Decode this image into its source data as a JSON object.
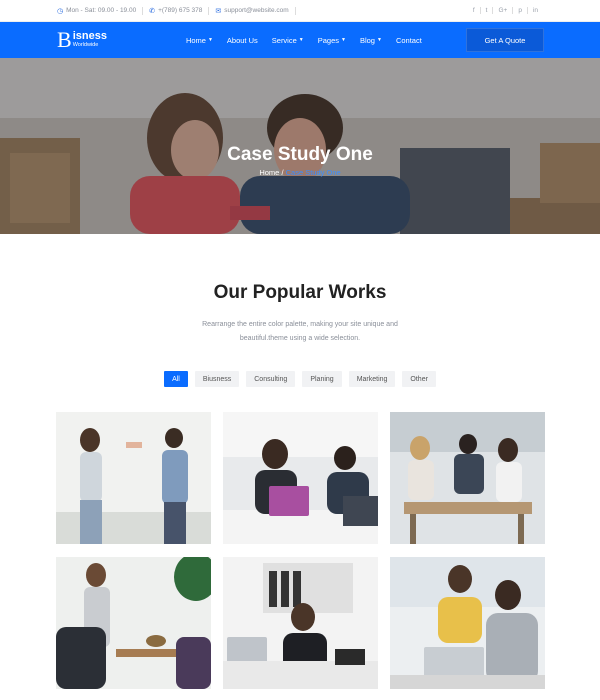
{
  "topbar": {
    "hours": "Mon - Sat: 09.00 - 19.00",
    "phone": "+(789) 675 378",
    "email": "support@website.com",
    "socials": [
      "f",
      "t",
      "G+",
      "p",
      "in"
    ],
    "icons": [
      "clock-icon",
      "phone-icon",
      "mail-icon"
    ]
  },
  "nav": {
    "logo_letter": "B",
    "logo_name": "isness",
    "logo_sub": "Worldwide",
    "items": [
      {
        "label": "Home",
        "dropdown": true
      },
      {
        "label": "About Us",
        "dropdown": false
      },
      {
        "label": "Service",
        "dropdown": true
      },
      {
        "label": "Pages",
        "dropdown": true
      },
      {
        "label": "Blog",
        "dropdown": true
      },
      {
        "label": "Contact",
        "dropdown": false
      }
    ],
    "cta": "Get A Quote"
  },
  "hero": {
    "title": "Case Study One",
    "breadcrumb_home": "Home",
    "breadcrumb_sep": "/",
    "breadcrumb_current": "Case Study One"
  },
  "works": {
    "title": "Our Popular Works",
    "desc_line1": "Rearrange the entire color palette, making your site unique and",
    "desc_line2": "beautiful.theme using a wide selection.",
    "filters": [
      "All",
      "Biusness",
      "Consulting",
      "Planing",
      "Marketing",
      "Other"
    ],
    "active_filter": "All"
  },
  "colors": {
    "brand": "#0a6cff",
    "heading": "#222222",
    "muted": "#8a8f99"
  }
}
